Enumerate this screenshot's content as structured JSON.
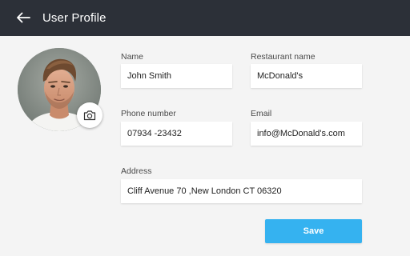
{
  "header": {
    "title": "User Profile",
    "back_icon": "arrow-left-icon",
    "background": "#2c3038"
  },
  "avatar": {
    "camera_icon": "camera-icon"
  },
  "form": {
    "name": {
      "label": "Name",
      "value": "John Smith"
    },
    "restaurant": {
      "label": "Restaurant name",
      "value": "McDonald's"
    },
    "phone": {
      "label": "Phone number",
      "value": "07934 -23432"
    },
    "email": {
      "label": "Email",
      "value": "info@McDonald's.com"
    },
    "address": {
      "label": "Address",
      "value": "Cliff Avenue 70 ,New London CT 06320"
    }
  },
  "actions": {
    "save_label": "Save",
    "save_color": "#35b2f0"
  }
}
